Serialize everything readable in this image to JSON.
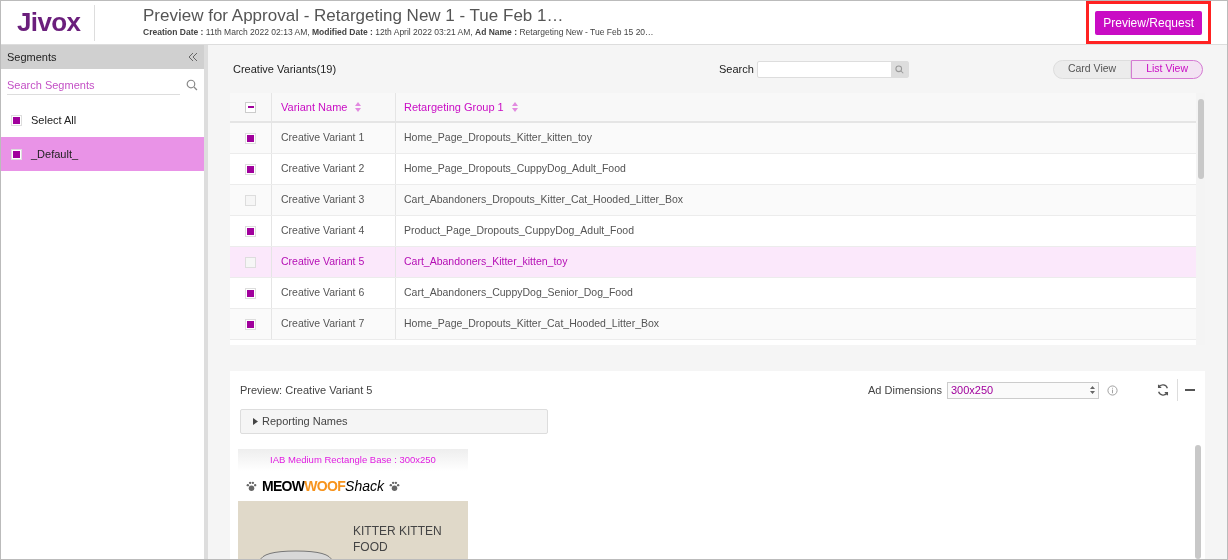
{
  "header": {
    "logo": "Jivox",
    "title": "Preview for Approval - Retargeting New 1 - Tue Feb 1…",
    "meta": "**Creation Date :** 11th March 2022 02:13 AM, **Modified Date :** 12th April 2022 03:21 AM, **Ad Name :** Retargeting New - Tue Feb 15 20…",
    "action": "Preview/Request"
  },
  "sidebar": {
    "title": "Segments",
    "search": {
      "placeholder": "Search Segments"
    },
    "items": [
      {
        "label": "Select All",
        "checked": true,
        "selected": false
      },
      {
        "label": "_Default_",
        "checked": true,
        "selected": true
      }
    ]
  },
  "variants": {
    "title": "Creative Variants(19)",
    "search_label": "Search",
    "select_all": {
      "indeterminate": true
    },
    "views": [
      {
        "label": "Card View",
        "selected": false
      },
      {
        "label": "List View",
        "selected": true
      }
    ],
    "columns": [
      "Variant Name",
      "Retargeting Group 1"
    ],
    "rows": [
      {
        "name": "Creative Variant 1",
        "group": "Home_Page_Dropouts_Kitter_kitten_toy",
        "checked": true,
        "selected": false
      },
      {
        "name": "Creative Variant 2",
        "group": "Home_Page_Dropouts_CuppyDog_Adult_Food",
        "checked": true,
        "selected": false
      },
      {
        "name": "Creative Variant 3",
        "group": "Cart_Abandoners_Dropouts_Kitter_Cat_Hooded_Litter_Box",
        "checked": false,
        "selected": false
      },
      {
        "name": "Creative Variant 4",
        "group": "Product_Page_Dropouts_CuppyDog_Adult_Food",
        "checked": true,
        "selected": false
      },
      {
        "name": "Creative Variant 5",
        "group": "Cart_Abandoners_Kitter_kitten_toy",
        "checked": false,
        "selected": true
      },
      {
        "name": "Creative Variant 6",
        "group": "Cart_Abandoners_CuppyDog_Senior_Dog_Food",
        "checked": true,
        "selected": false
      },
      {
        "name": "Creative Variant 7",
        "group": "Home_Page_Dropouts_Kitter_Cat_Hooded_Litter_Box",
        "checked": true,
        "selected": false
      }
    ]
  },
  "preview": {
    "title": "Preview: Creative Variant 5",
    "dimensions_label": "Ad Dimensions",
    "dimensions": "300x250",
    "reporting": {
      "label": "Reporting Names",
      "expanded": false
    },
    "ad": {
      "caption": "IAB Medium Rectangle Base : 300x250",
      "brand": [
        {
          "text": "MEOW",
          "kind": "bold"
        },
        {
          "text": "WOOF",
          "kind": "accent"
        },
        {
          "text": "Shack",
          "kind": "italic"
        }
      ],
      "headline": "KITTER KITTEN FOOD"
    }
  }
}
